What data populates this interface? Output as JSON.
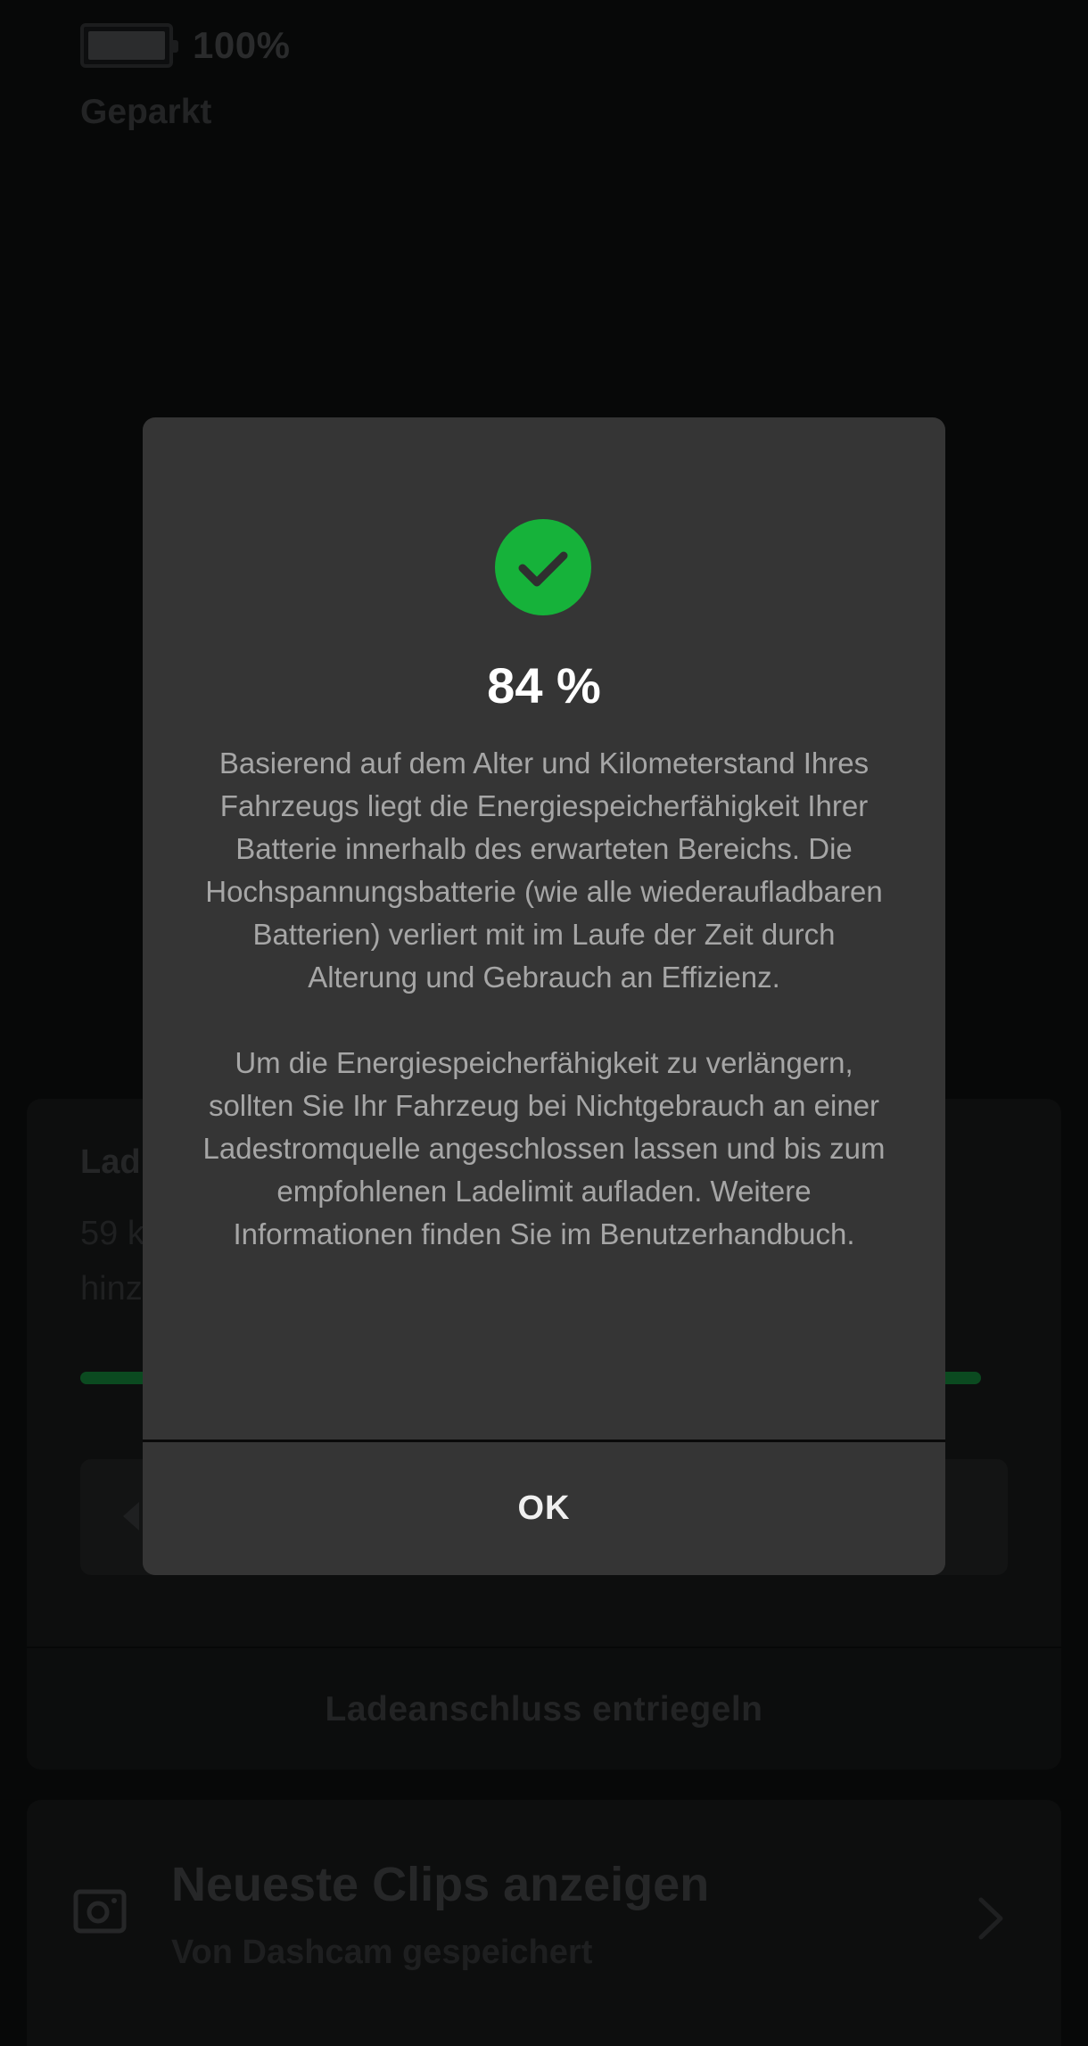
{
  "status_bar": {
    "battery_percent": "100%",
    "battery_level": 1.0,
    "vehicle_state": "Geparkt"
  },
  "charging_card": {
    "title": "Lad",
    "subtitle": "59 k\nhinz",
    "unlock_port_label": "Ladeanschluss entriegeln"
  },
  "clips_card": {
    "title": "Neueste Clips anzeigen",
    "subtitle": "Von Dashcam gespeichert",
    "icon": "camera-icon"
  },
  "dialog": {
    "icon": "check-circle-icon",
    "value": "84 %",
    "paragraph_1": "Basierend auf dem Alter und Kilometerstand Ihres Fahrzeugs liegt die Energiespeicherfähigkeit Ihrer Batterie innerhalb des erwarteten Bereichs. Die Hochspannungsbatterie (wie alle wiederaufladbaren Batterien) verliert mit im Laufe der Zeit durch Alterung und Gebrauch an Effizienz.",
    "paragraph_2": "Um die Energiespeicherfähigkeit zu verlängern, sollten Sie Ihr Fahrzeug bei Nichtgebrauch an einer Ladestromquelle angeschlossen lassen und bis zum empfohlenen Ladelimit aufladen. Weitere Informationen finden Sie im Benutzerhandbuch.",
    "ok_label": "OK"
  },
  "colors": {
    "background": "#070808",
    "dialog_background": "#353535",
    "accent_green": "#16b23a",
    "body_text": "#a6a6a6"
  }
}
